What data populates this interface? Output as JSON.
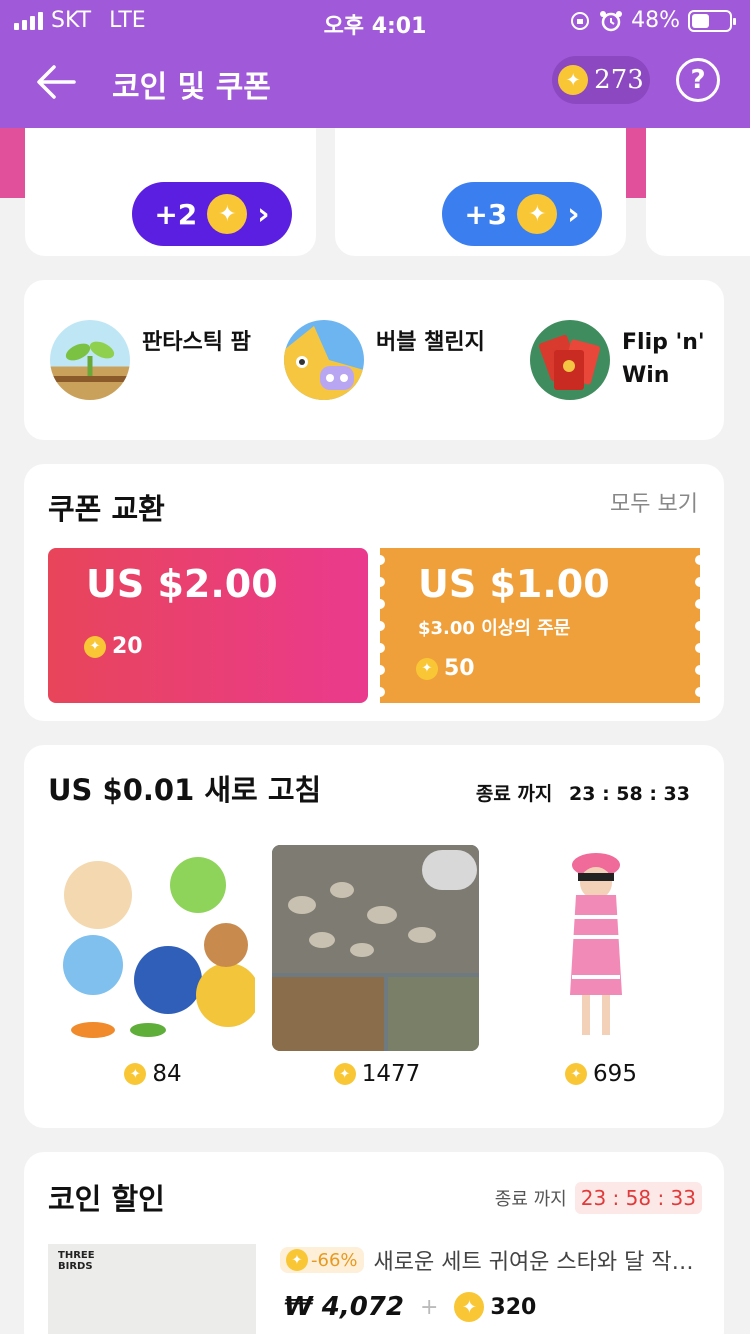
{
  "status": {
    "carrier": "SKT",
    "network": "LTE",
    "time": "오후 4:01",
    "battery": "48%",
    "battery_level": 0.48
  },
  "header": {
    "title": "코인 및 쿠폰",
    "coins": "273",
    "help": "?"
  },
  "rewards": [
    {
      "label": "+2",
      "color": "#5a1fe0"
    },
    {
      "label": "+3",
      "color": "#3b7ef0"
    }
  ],
  "games": [
    {
      "name": "판타스틱 팜",
      "icon": "sprout-icon"
    },
    {
      "name": "버블 챌린지",
      "icon": "bubble-monster-icon"
    },
    {
      "name": "Flip 'n' Win",
      "name_line1": "Flip 'n'",
      "name_line2": "Win",
      "icon": "red-envelope-icon"
    }
  ],
  "coupons": {
    "title": "쿠폰 교환",
    "see_all": "모두 보기",
    "items": [
      {
        "amount": "US $2.00",
        "condition": "",
        "price": "20",
        "color": "#e8457a"
      },
      {
        "amount": "US $1.00",
        "condition": "$3.00 이상의 주문",
        "price": "50",
        "color": "#f0a03a"
      }
    ]
  },
  "flash": {
    "title": "US $0.01 새로 고침",
    "ends_label": "종료 까지",
    "time": "23 : 58 : 33",
    "products": [
      {
        "price": "84",
        "image": "squishy-toy-balls"
      },
      {
        "price": "1477",
        "image": "river-pebbles"
      },
      {
        "price": "695",
        "image": "girl-striped-dress"
      }
    ]
  },
  "coin_discount": {
    "title": "코인 할인",
    "ends_label": "종료 까지",
    "hours": "23",
    "minutes": "58",
    "seconds": "33",
    "product": {
      "brand": "THREE BIRDS",
      "brand_line1": "THREE",
      "brand_line2": "BIRDS",
      "discount": "-66%",
      "name": "새로운 세트 귀여운 스타와 달 작…",
      "price": "₩ 4,072",
      "plus": "+",
      "coins": "320"
    }
  }
}
